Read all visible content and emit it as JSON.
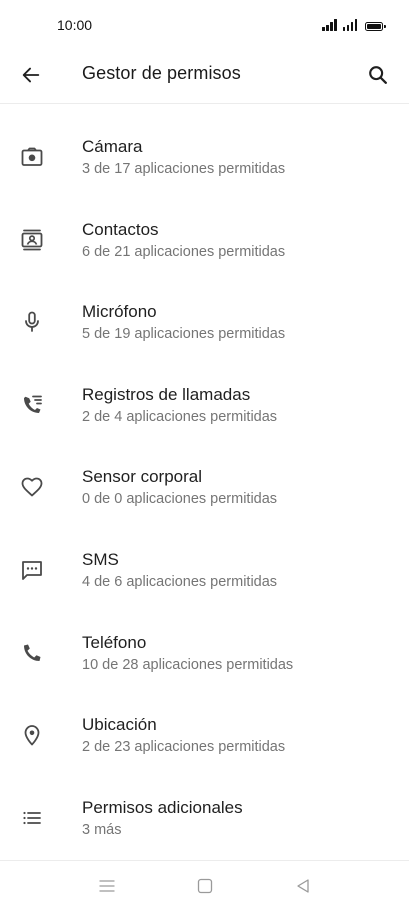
{
  "status_bar": {
    "time": "10:00"
  },
  "app_bar": {
    "title": "Gestor de permisos",
    "back_icon": "arrow-back-icon",
    "search_icon": "search-icon"
  },
  "permissions": [
    {
      "title": "Cámara",
      "subtitle": "3 de 17 aplicaciones permitidas",
      "icon": "camera-icon"
    },
    {
      "title": "Contactos",
      "subtitle": "6 de 21 aplicaciones permitidas",
      "icon": "contacts-icon"
    },
    {
      "title": "Micrófono",
      "subtitle": "5 de 19 aplicaciones permitidas",
      "icon": "microphone-icon"
    },
    {
      "title": "Registros de llamadas",
      "subtitle": "2 de 4 aplicaciones permitidas",
      "icon": "call-log-icon"
    },
    {
      "title": "Sensor corporal",
      "subtitle": "0 de 0 aplicaciones permitidas",
      "icon": "heart-icon"
    },
    {
      "title": "SMS",
      "subtitle": "4 de 6 aplicaciones permitidas",
      "icon": "sms-icon"
    },
    {
      "title": "Teléfono",
      "subtitle": "10 de 28 aplicaciones permitidas",
      "icon": "phone-icon"
    },
    {
      "title": "Ubicación",
      "subtitle": "2 de 23 aplicaciones permitidas",
      "icon": "location-icon"
    },
    {
      "title": "Permisos adicionales",
      "subtitle": "3 más",
      "icon": "list-icon"
    }
  ],
  "nav_bar": {
    "menu_icon": "menu-icon",
    "home_icon": "home-icon",
    "back_icon": "back-triangle-icon"
  },
  "colors": {
    "text_primary": "#1f1f1f",
    "text_secondary": "#757575",
    "icon": "#4a4a4a",
    "divider": "#ececec",
    "background": "#ffffff"
  }
}
